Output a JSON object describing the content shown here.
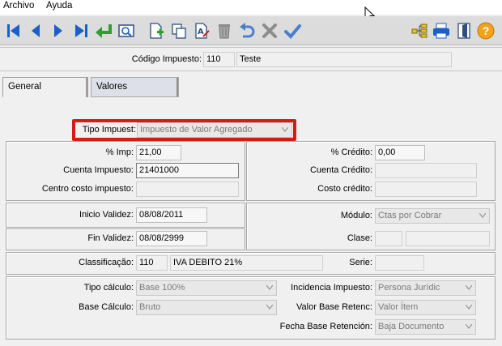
{
  "menu": {
    "archivo": "Archivo",
    "ayuda": "Ayuda"
  },
  "toolbar": {
    "icons": [
      "first-record-icon",
      "previous-record-icon",
      "next-record-icon",
      "last-record-icon",
      "enter-icon",
      "search-icon",
      "new-document-icon",
      "copy-icon",
      "edit-document-icon",
      "delete-icon",
      "undo-icon",
      "cancel-icon",
      "confirm-icon",
      "tree-icon",
      "print-icon",
      "exit-icon",
      "help-icon"
    ],
    "help_glyph": "?"
  },
  "header": {
    "codigo_label": "Código Impuesto:",
    "codigo_value": "110",
    "name_value": "Teste"
  },
  "tabs": [
    {
      "label": "General"
    },
    {
      "label": "Valores"
    }
  ],
  "tipo_impuesto": {
    "label": "Tipo Impuest:",
    "value": "Impuesto de Valor Agregado"
  },
  "left_panel": {
    "imp_label": "% Imp:",
    "imp_value": "21,00",
    "cuenta_label": "Cuenta Impuesto:",
    "cuenta_value": "21401000",
    "centro_label": "Centro costo impuesto:",
    "centro_value": ""
  },
  "right_panel": {
    "credito_label": "% Crédito:",
    "credito_value": "0,00",
    "cuenta_credito_label": "Cuenta Crédito:",
    "cuenta_credito_value": "",
    "costo_credito_label": "Costo crédito:",
    "costo_credito_value": ""
  },
  "validity": {
    "inicio_label": "Inicio Validez:",
    "inicio_value": "08/08/2011",
    "fin_label": "Fin Validez:",
    "fin_value": "08/08/2999"
  },
  "modulo": {
    "label": "Módulo:",
    "value": "Ctas por Cobrar",
    "clase_label": "Clase:",
    "clase_value_1": "",
    "clase_value_2": ""
  },
  "classification": {
    "label": "Classificação:",
    "code": "110",
    "description": "IVA DEBITO 21%",
    "serie_label": "Serie:",
    "serie_value": ""
  },
  "calc": {
    "tipo_calculo_label": "Tipo cálculo:",
    "tipo_calculo_value": "Base 100%",
    "base_calculo_label": "Base Cálculo:",
    "base_calculo_value": "Bruto",
    "incidencia_label": "Incidencia Impuesto:",
    "incidencia_value": "Persona Jurídic",
    "valor_base_label": "Valor Base Retenc:",
    "valor_base_value": "Valor Ítem",
    "fecha_base_label": "Fecha Base Retención:",
    "fecha_base_value": "Baja Documento"
  },
  "colors": {
    "accent_blue": "#1a5fc7",
    "highlight_red": "#d51a1a",
    "toolbar_bg": "#dcdcdc",
    "tab_inactive_bg": "#dde0e9"
  }
}
